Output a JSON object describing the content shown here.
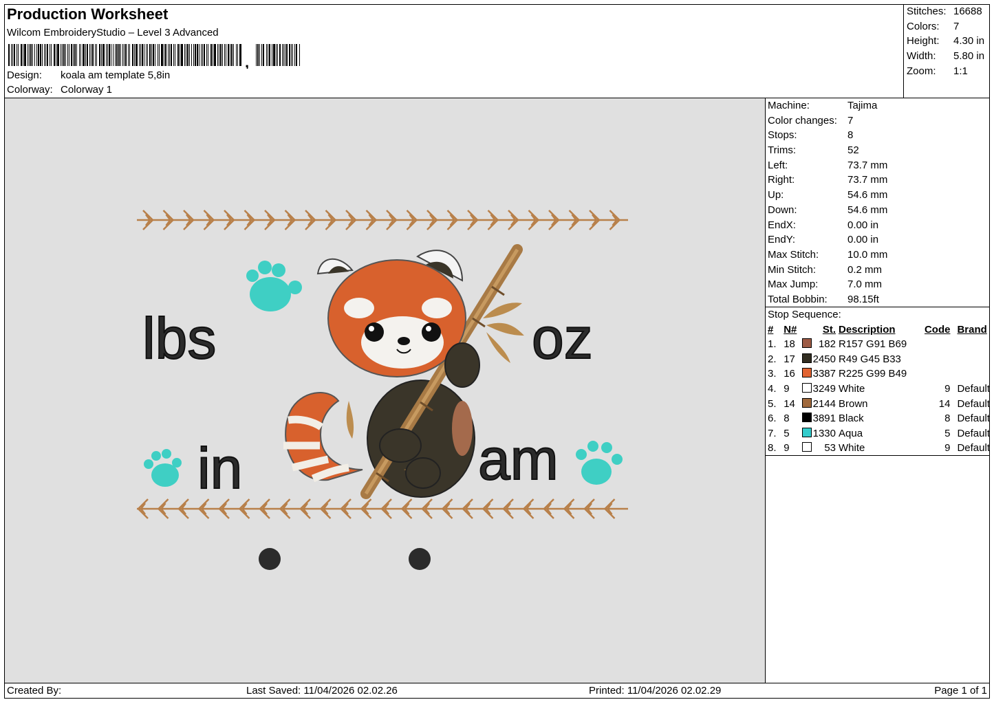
{
  "header": {
    "title": "Production Worksheet",
    "software": "Wilcom EmbroideryStudio – Level 3 Advanced",
    "barcode_suffix": ",",
    "design_label": "Design:",
    "design_value": "koala am template 5,8in",
    "colorway_label": "Colorway:",
    "colorway_value": "Colorway 1"
  },
  "summary": [
    {
      "label": "Stitches:",
      "value": "16688"
    },
    {
      "label": "Colors:",
      "value": "7"
    },
    {
      "label": "Height:",
      "value": "4.30 in"
    },
    {
      "label": "Width:",
      "value": "5.80 in"
    },
    {
      "label": "Zoom:",
      "value": "1:1"
    }
  ],
  "properties": [
    {
      "label": "Machine:",
      "value": "Tajima"
    },
    {
      "label": "Color changes:",
      "value": "7"
    },
    {
      "label": "Stops:",
      "value": "8"
    },
    {
      "label": "Trims:",
      "value": "52"
    },
    {
      "label": "Left:",
      "value": "73.7 mm"
    },
    {
      "label": "Right:",
      "value": "73.7 mm"
    },
    {
      "label": "Up:",
      "value": "54.6 mm"
    },
    {
      "label": "Down:",
      "value": "54.6 mm"
    },
    {
      "label": "EndX:",
      "value": "0.00 in"
    },
    {
      "label": "EndY:",
      "value": "0.00 in"
    },
    {
      "label": "Max Stitch:",
      "value": "10.0 mm"
    },
    {
      "label": "Min Stitch:",
      "value": "0.2 mm"
    },
    {
      "label": "Max Jump:",
      "value": "7.0 mm"
    },
    {
      "label": "Total Bobbin:",
      "value": "98.15ft"
    }
  ],
  "stop_sequence": {
    "label": "Stop Sequence:",
    "columns": [
      "#",
      "N#",
      "St.",
      "Description",
      "Code",
      "Brand"
    ],
    "rows": [
      {
        "num": "1.",
        "n": "18",
        "color": "#9d5b45",
        "st": "182",
        "desc": "R157 G91 B69",
        "code": "",
        "brand": ""
      },
      {
        "num": "2.",
        "n": "17",
        "color": "#312d21",
        "st": "2450",
        "desc": "R49 G45 B33",
        "code": "",
        "brand": ""
      },
      {
        "num": "3.",
        "n": "16",
        "color": "#e16331",
        "st": "3387",
        "desc": "R225 G99 B49",
        "code": "",
        "brand": ""
      },
      {
        "num": "4.",
        "n": "9",
        "color": "#ffffff",
        "st": "3249",
        "desc": "White",
        "code": "9",
        "brand": "Default"
      },
      {
        "num": "5.",
        "n": "14",
        "color": "#a0693c",
        "st": "2144",
        "desc": "Brown",
        "code": "14",
        "brand": "Default"
      },
      {
        "num": "6.",
        "n": "8",
        "color": "#000000",
        "st": "3891",
        "desc": "Black",
        "code": "8",
        "brand": "Default"
      },
      {
        "num": "7.",
        "n": "5",
        "color": "#33cccc",
        "st": "1330",
        "desc": "Aqua",
        "code": "5",
        "brand": "Default"
      },
      {
        "num": "8.",
        "n": "9",
        "color": "#ffffff",
        "st": "53",
        "desc": "White",
        "code": "9",
        "brand": "Default"
      }
    ]
  },
  "design_text": {
    "lbs": "lbs",
    "oz": "oz",
    "in": "in",
    "am": "am"
  },
  "footer": {
    "created_by": "Created By:",
    "last_saved": "Last Saved: 11/04/2026 02.02.26",
    "printed": "Printed: 11/04/2026 02.02.29",
    "page": "Page 1 of 1"
  },
  "colors": {
    "preview_bg": "#e0e0e0",
    "arrow_brown": "#b8804a",
    "aqua": "#3fcfc4",
    "panda_orange": "#d8612d",
    "panda_dark": "#3a3529",
    "bamboo": "#a87a45"
  }
}
